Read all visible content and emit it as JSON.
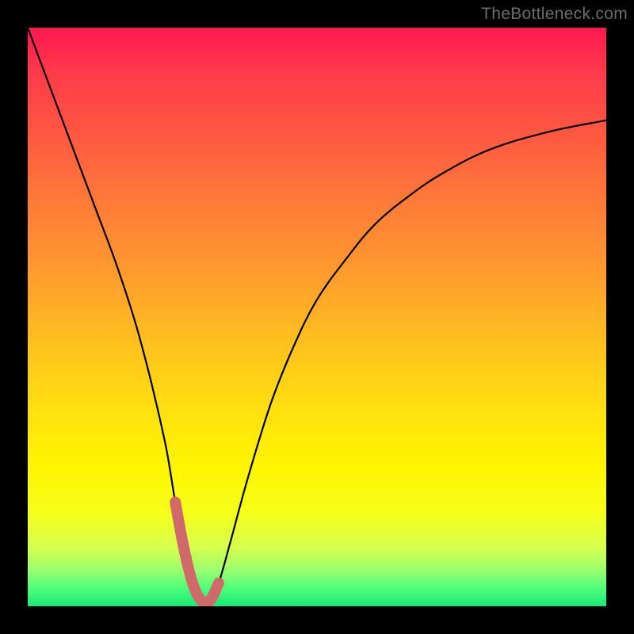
{
  "watermark": {
    "text": "TheBottleneck.com"
  },
  "colors": {
    "page_bg": "#000000",
    "curve": "#000000",
    "marker_fill": "#d06a6a",
    "marker_stroke": "#c95a5a",
    "gradient_top": "#ff1850",
    "gradient_bottom": "#17e877"
  },
  "chart_data": {
    "type": "line",
    "title": "",
    "xlabel": "",
    "ylabel": "",
    "xlim": [
      0,
      100
    ],
    "ylim": [
      0,
      100
    ],
    "grid": false,
    "legend": false,
    "series": [
      {
        "name": "curve",
        "x": [
          0,
          3,
          6,
          9,
          12,
          15,
          18,
          20,
          22,
          24,
          25.5,
          27,
          28.5,
          30,
          31.5,
          33,
          35,
          38,
          42,
          46,
          50,
          55,
          60,
          66,
          72,
          80,
          90,
          100
        ],
        "values": [
          100,
          92,
          84,
          76,
          68,
          60,
          51,
          44,
          36,
          27,
          18,
          10,
          4,
          1,
          1,
          4,
          11,
          22,
          35,
          45,
          53,
          60,
          66,
          71,
          75,
          79,
          82,
          84
        ]
      }
    ],
    "markers": {
      "name": "trough-highlight",
      "x": [
        25.5,
        27,
        28.5,
        30,
        31.5,
        33
      ],
      "values": [
        18,
        10,
        4,
        1,
        1,
        4
      ]
    }
  }
}
